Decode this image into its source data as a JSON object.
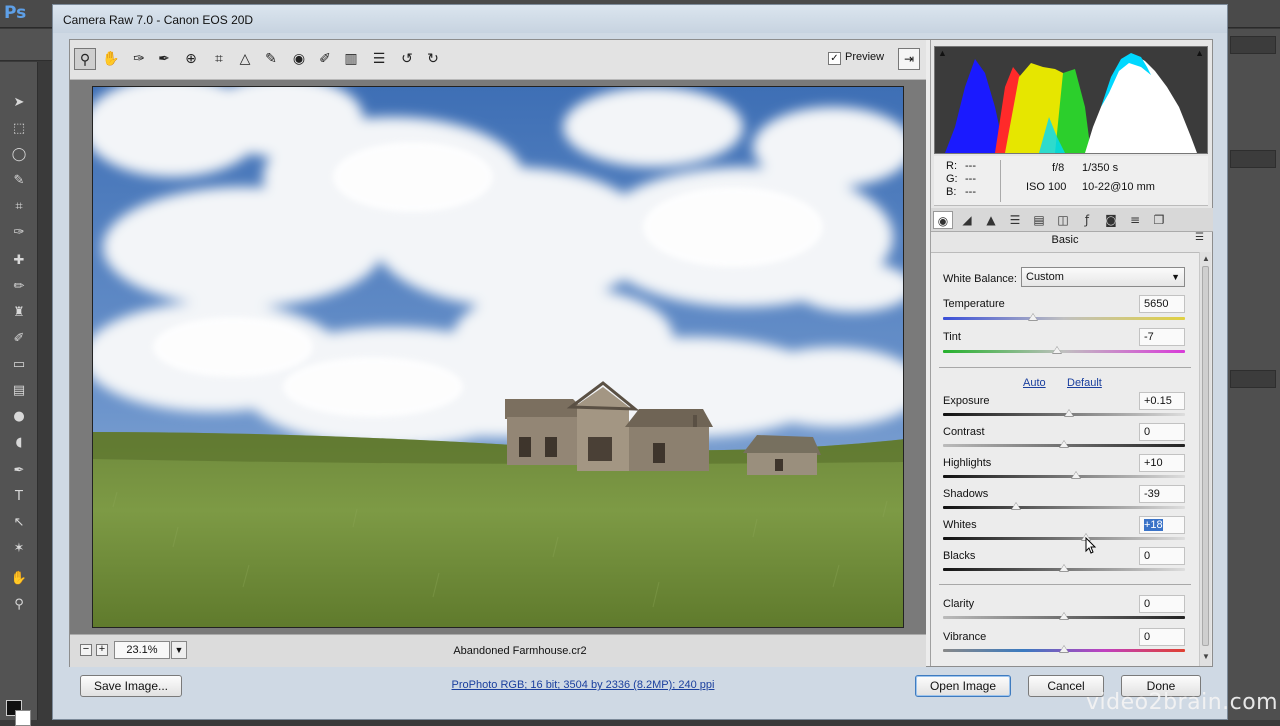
{
  "ps": {
    "logo": "Ps"
  },
  "dialog": {
    "title": "Camera Raw 7.0  -  Canon EOS 20D"
  },
  "toolbar": {
    "preview_label": "Preview",
    "preview_checked": "✓"
  },
  "image": {
    "zoom": "23.1%",
    "filename": "Abandoned Farmhouse.cr2"
  },
  "histogram": {
    "r_label": "R:",
    "g_label": "G:",
    "b_label": "B:",
    "r_value": "---",
    "g_value": "---",
    "b_value": "---",
    "aperture": "f/8",
    "shutter": "1/350 s",
    "iso": "ISO 100",
    "lens": "10-22@10 mm"
  },
  "panel": {
    "name": "Basic",
    "white_balance_label": "White Balance:",
    "white_balance_value": "Custom",
    "auto_link": "Auto",
    "default_link": "Default",
    "sliders": {
      "temperature": {
        "label": "Temperature",
        "value": "5650",
        "position": 0.37
      },
      "tint": {
        "label": "Tint",
        "value": "-7",
        "position": 0.47
      },
      "exposure": {
        "label": "Exposure",
        "value": "+0.15",
        "position": 0.52
      },
      "contrast": {
        "label": "Contrast",
        "value": "0",
        "position": 0.5
      },
      "highlights": {
        "label": "Highlights",
        "value": "+10",
        "position": 0.55
      },
      "shadows": {
        "label": "Shadows",
        "value": "-39",
        "position": 0.3
      },
      "whites": {
        "label": "Whites",
        "value": "+18",
        "position": 0.59
      },
      "blacks": {
        "label": "Blacks",
        "value": "0",
        "position": 0.5
      },
      "clarity": {
        "label": "Clarity",
        "value": "0",
        "position": 0.5
      },
      "vibrance": {
        "label": "Vibrance",
        "value": "0",
        "position": 0.5
      }
    }
  },
  "footer": {
    "save_image": "Save Image...",
    "workflow": "ProPhoto RGB; 16 bit; 3504 by 2336 (8.2MP); 240 ppi",
    "open_image": "Open Image",
    "cancel": "Cancel",
    "done": "Done"
  },
  "watermark": "video2brain.com"
}
